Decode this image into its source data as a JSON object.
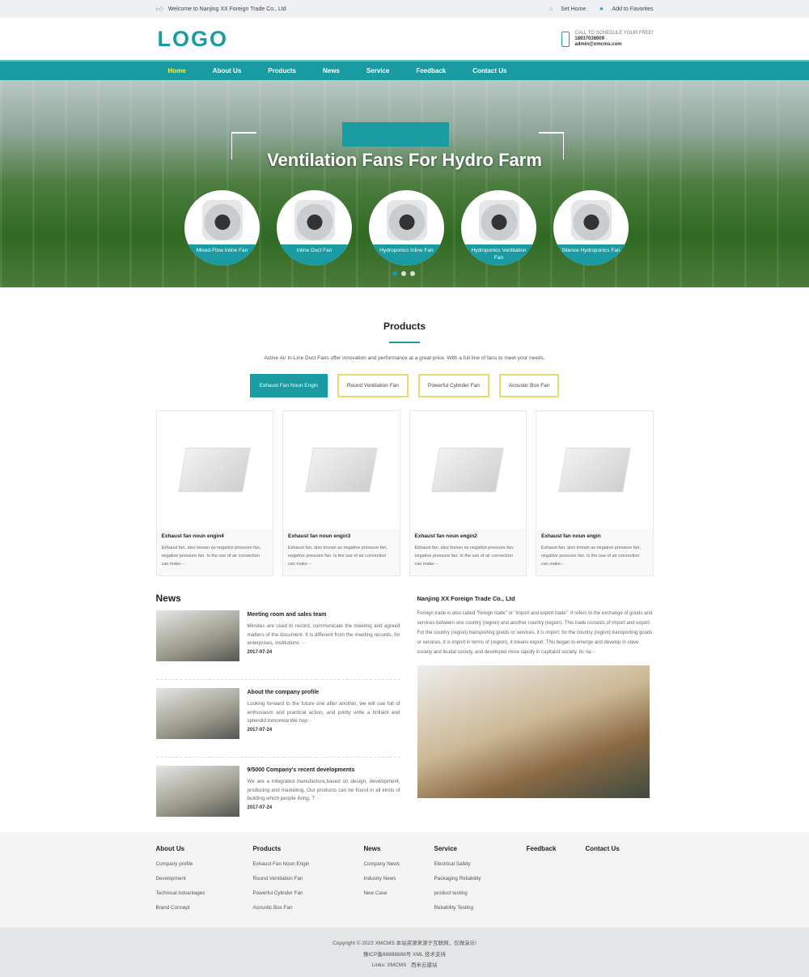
{
  "topbar": {
    "welcome": "Welcome to Nanjing XX Foreign Trade Co., Ltd",
    "set_home": "Set Home",
    "favorites": "Add to Favorites"
  },
  "header": {
    "logo": "LOGO",
    "call": "CALL TO SCHEDULE YOUR FREE!",
    "phone": "18937038909",
    "email": "admin@xmcms.com"
  },
  "nav": [
    "Home",
    "About Us",
    "Products",
    "News",
    "Service",
    "Feedback",
    "Contact Us"
  ],
  "banner": {
    "title": "Ventilation Fans For Hydro Farm",
    "items": [
      "Mixed-Flow Inline Fan",
      "Inline Duct Fan",
      "Hydroponics Inline Fan",
      "Hydroponics Ventilation Fan",
      "Silence Hydroponics Fan"
    ],
    "slides": 3,
    "active_slide": 1
  },
  "products": {
    "title": "Products",
    "desc": "Active Air In-Line Duct Fans offer innovation and performance at a great price. With a full line of fans to meet your needs.",
    "tabs": [
      "Exhaust Fan Noun Engin",
      "Round Ventilation Fan",
      "Powerful Cylinder Fan",
      "Acoustic Box Fan"
    ],
    "cards": [
      {
        "title": "Exhaust fan noun engin4",
        "desc": "Exhaust fan, also known as negative pressure fan, negative pressure fan. Is the use of air convection can make···"
      },
      {
        "title": "Exhaust fan noun engin3",
        "desc": "Exhaust fan, also known as negative pressure fan, negative pressure fan. Is the use of air convection can make···"
      },
      {
        "title": "Exhaust fan noun engin2",
        "desc": "Exhaust fan, also known as negative pressure fan, negative pressure fan. Is the use of air convection can make···"
      },
      {
        "title": "Exhaust fan noun engin",
        "desc": "Exhaust fan, also known as negative pressure fan, negative pressure fan. Is the use of air convection can make···"
      }
    ]
  },
  "news": {
    "title": "News",
    "items": [
      {
        "title": "Meeting room and sales team",
        "desc": "Minutes are used to record, communicate the meeting and agreed matters of the document. It is different from the meeting records, for enterprises, institutions ···",
        "date": "2017-07-24"
      },
      {
        "title": "About the company profile",
        "desc": "Looking forward to the future one after another, we will use full of enthusiasm and practical action, and jointly write a brilliant and splendid tomorrow.We hop···",
        "date": "2017-07-24"
      },
      {
        "title": "9/5000 Company's recent developments",
        "desc": "We are a integrated manufacture,based on design, development, producing and marketing. Our products can be found in all kinds of building which people living. T···",
        "date": "2017-07-24"
      }
    ]
  },
  "about": {
    "title": "Nanjing XX Foreign Trade Co., Ltd",
    "text": "Foreign trade is also called \"foreign trade\" or \"import and export trade\". It refers to the exchange of goods and services between one country (region) and another country (region). This trade consists of import and export. For the country (region) transporting goods or services, it is import; for the country (region) transporting goods or services, it is import in terms of (region), it means export. This began to emerge and develop in slave society and feudal society, and developed more rapidly in capitalist society. Its na···"
  },
  "footer": {
    "cols": [
      {
        "title": "About Us",
        "links": [
          "Company profile",
          "Development",
          "Technical Advantages",
          "Brand Concept"
        ]
      },
      {
        "title": "Products",
        "links": [
          "Exhaust Fan Noun Engin",
          "Round Ventilation Fan",
          "Powerful Cylinder Fan",
          "Acoustic Box Fan"
        ]
      },
      {
        "title": "News",
        "links": [
          "Company News",
          "Industry News",
          "New Case"
        ]
      },
      {
        "title": "Service",
        "links": [
          "Electrical Safety",
          "Packaging Reliability",
          "product testing",
          "Reliability Testing"
        ]
      },
      {
        "title": "Feedback",
        "links": []
      },
      {
        "title": "Contact Us",
        "links": []
      }
    ],
    "copyright": "Copyright © 2023 XMCMS 本站资源来源于互联网，仅做演示!",
    "icp": "豫ICP备88888888号 XML 技术支持",
    "links_label": "Links:",
    "links": [
      "XMCMS",
      "西米云建站"
    ]
  },
  "colors": {
    "accent": "#1a9ba1",
    "nav_active": "#f5f53a",
    "tab_border": "#e8dc70"
  }
}
